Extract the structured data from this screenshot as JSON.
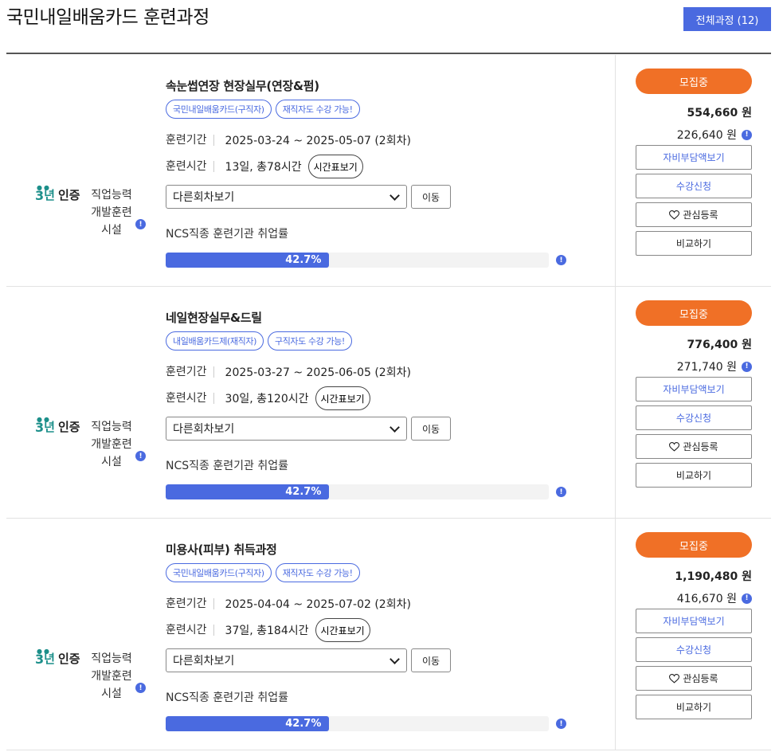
{
  "page": {
    "title": "국민내일배움카드 훈련과정",
    "all_courses_label": "전체과정 (12)"
  },
  "labels": {
    "period": "훈련기간",
    "hours": "훈련시간",
    "timetable": "시간표보기",
    "other_rounds": "다른회차보기",
    "move": "이동",
    "ncs": "NCS직종 훈련기관 취업률",
    "cert_year": "3",
    "cert_year_unit": "년",
    "cert_text": "인증",
    "facility_line1": "직업능력",
    "facility_line2": "개발훈련",
    "facility_line3": "시설",
    "self_pay_btn": "자비부담액보기",
    "apply_btn": "수강신청",
    "wish_btn": "관심등록",
    "compare_btn": "비교하기",
    "info_glyph": "!"
  },
  "colors": {
    "accent_blue": "#4a6ae0",
    "status_orange": "#f07026",
    "cert_teal": "#1c8f8a"
  },
  "courses": [
    {
      "title": "속눈썹연장 현장실무(연장&펌)",
      "tags": [
        "국민내일배움카드(구직자)",
        "재직자도 수강 가능!"
      ],
      "period": "2025-03-24 ~ 2025-05-07 (2회차)",
      "hours": "13일, 총78시간",
      "employment_rate_label": "42.7%",
      "employment_rate_pct": 42.7,
      "status": "모집중",
      "price": "554,660 원",
      "self_price": "226,640 원"
    },
    {
      "title": "네일현장실무&드릴",
      "tags": [
        "내일배움카드제(재직자)",
        "구직자도 수강 가능!"
      ],
      "period": "2025-03-27 ~ 2025-06-05 (2회차)",
      "hours": "30일, 총120시간",
      "employment_rate_label": "42.7%",
      "employment_rate_pct": 42.7,
      "status": "모집중",
      "price": "776,400 원",
      "self_price": "271,740 원"
    },
    {
      "title": "미용사(피부) 취득과정",
      "tags": [
        "국민내일배움카드(구직자)",
        "재직자도 수강 가능!"
      ],
      "period": "2025-04-04 ~ 2025-07-02 (2회차)",
      "hours": "37일, 총184시간",
      "employment_rate_label": "42.7%",
      "employment_rate_pct": 42.7,
      "status": "모집중",
      "price": "1,190,480 원",
      "self_price": "416,670 원"
    }
  ]
}
